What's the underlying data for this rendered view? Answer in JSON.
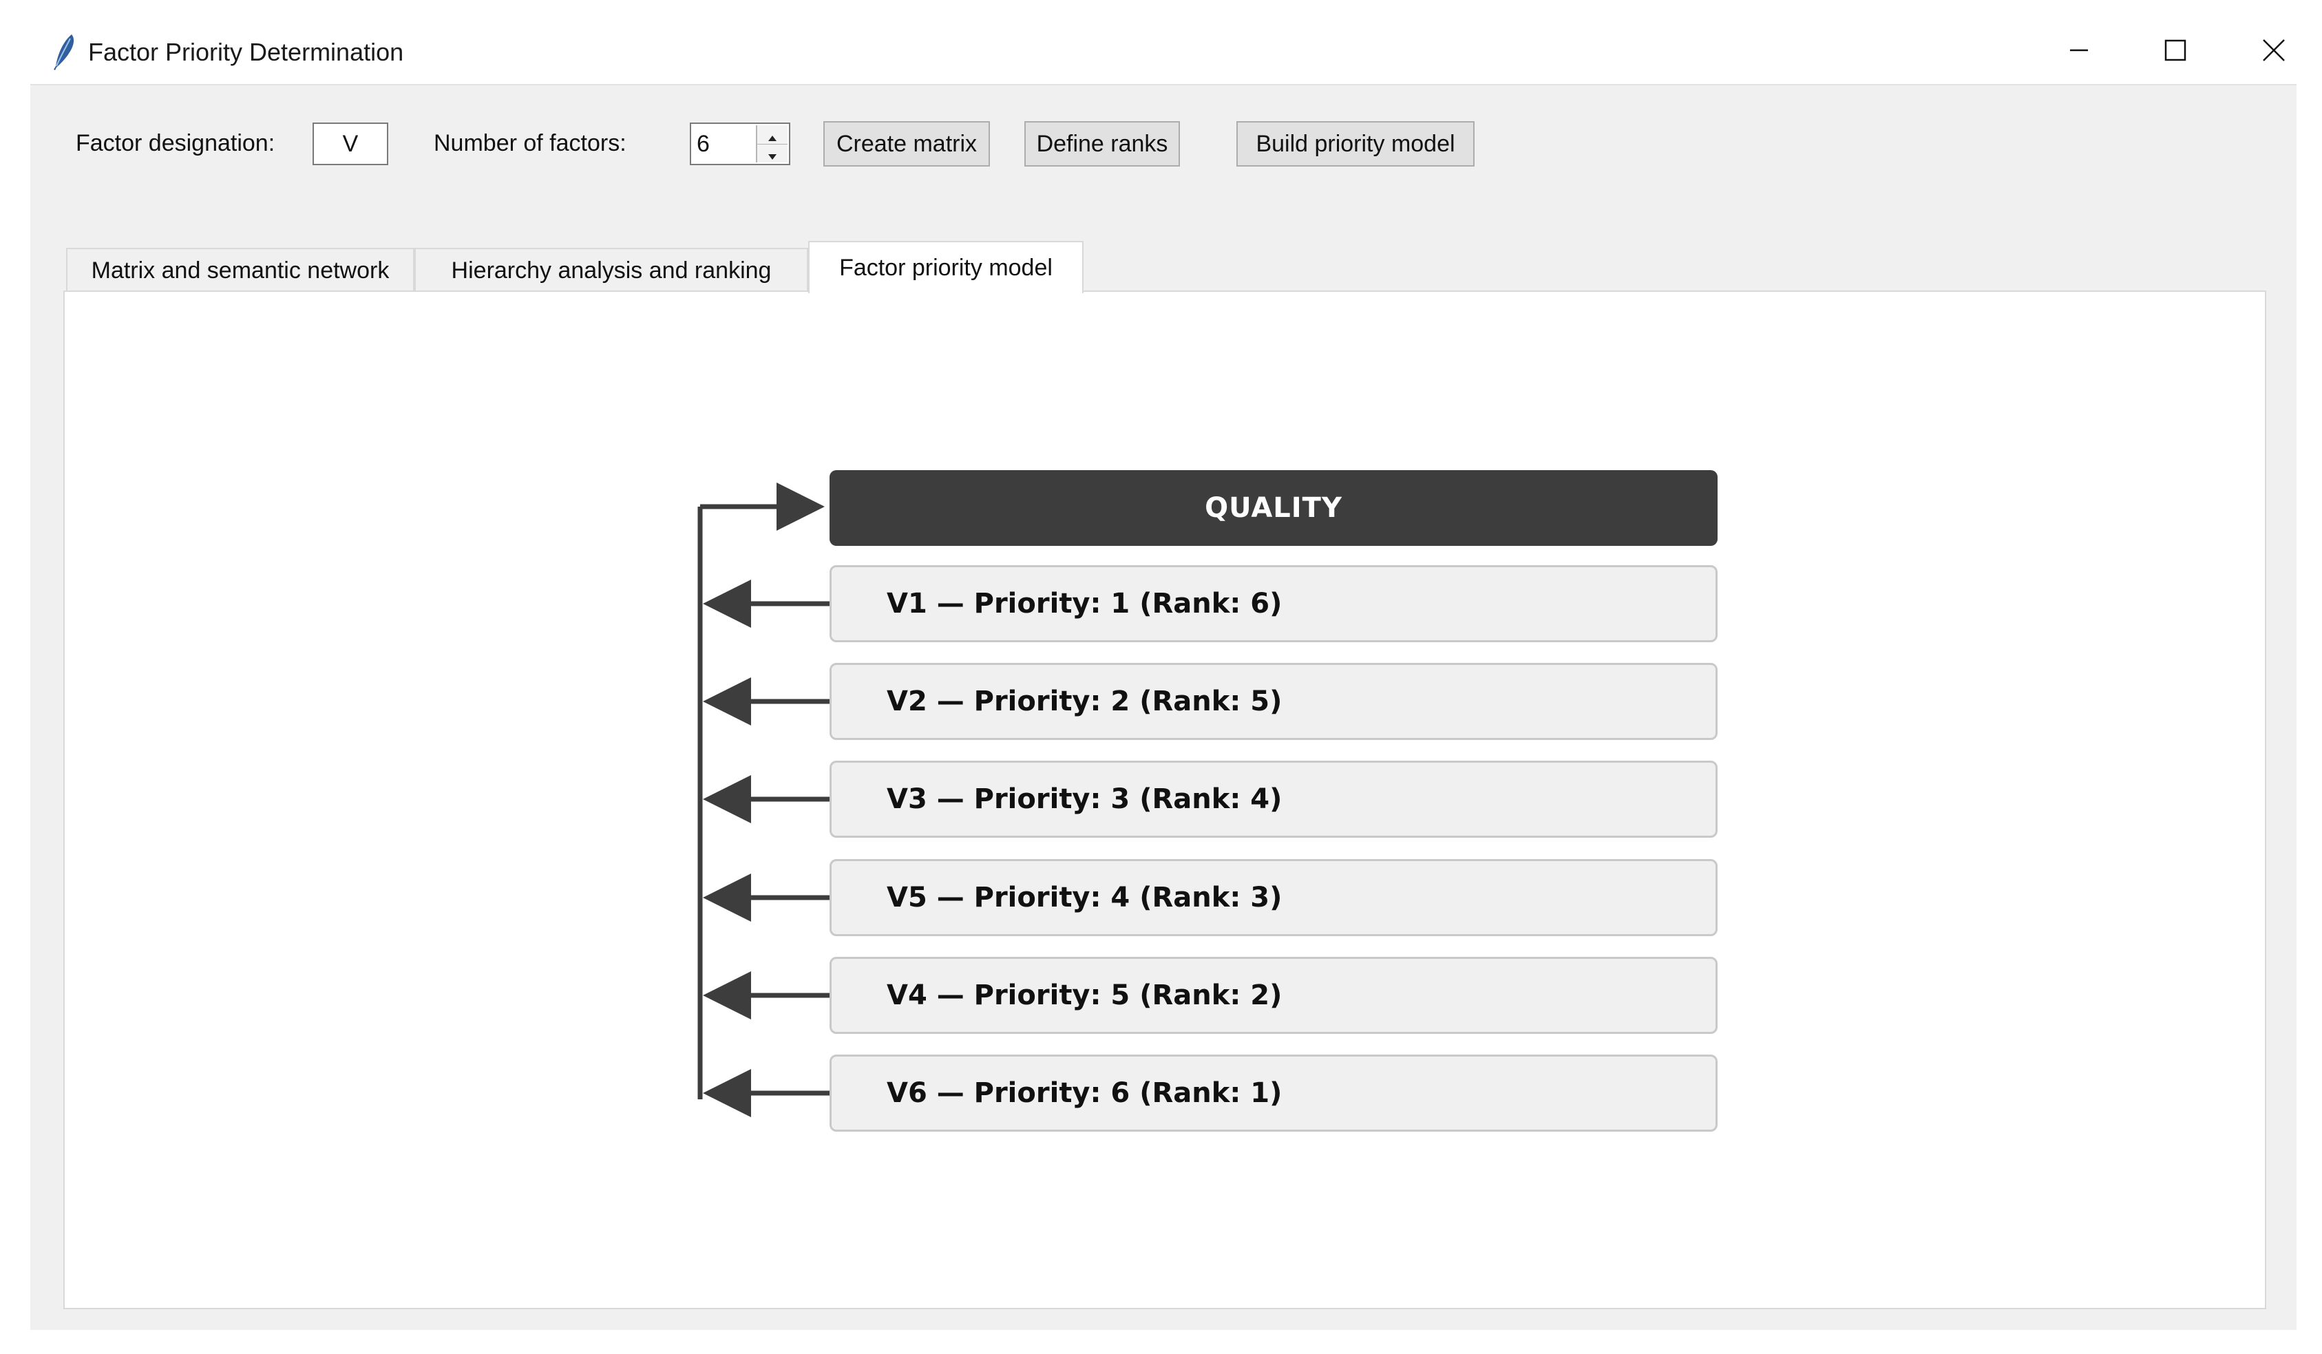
{
  "window": {
    "title": "Factor Priority Determination"
  },
  "toolbar": {
    "factor_designation_label": "Factor designation:",
    "factor_designation_value": "V",
    "number_of_factors_label": "Number of factors:",
    "number_of_factors_value": "6",
    "create_matrix_label": "Create matrix",
    "define_ranks_label": "Define ranks",
    "build_model_label": "Build priority model"
  },
  "tabs": [
    {
      "label": "Matrix and semantic network",
      "active": false
    },
    {
      "label": "Hierarchy analysis and ranking",
      "active": false
    },
    {
      "label": "Factor priority model",
      "active": true
    }
  ],
  "model": {
    "root_label": "QUALITY",
    "root_color": "#3d3d3d",
    "factors": [
      {
        "label": "V1 — Priority: 1 (Rank: 6)"
      },
      {
        "label": "V2 — Priority: 2 (Rank: 5)"
      },
      {
        "label": "V3 — Priority: 3 (Rank: 4)"
      },
      {
        "label": "V5 — Priority: 4 (Rank: 3)"
      },
      {
        "label": "V4 — Priority: 5 (Rank: 2)"
      },
      {
        "label": "V6 — Priority: 6 (Rank: 1)"
      }
    ]
  },
  "icons": {
    "app": "feather-icon",
    "minimize": "minimize-icon",
    "maximize": "maximize-icon",
    "close": "close-icon"
  }
}
